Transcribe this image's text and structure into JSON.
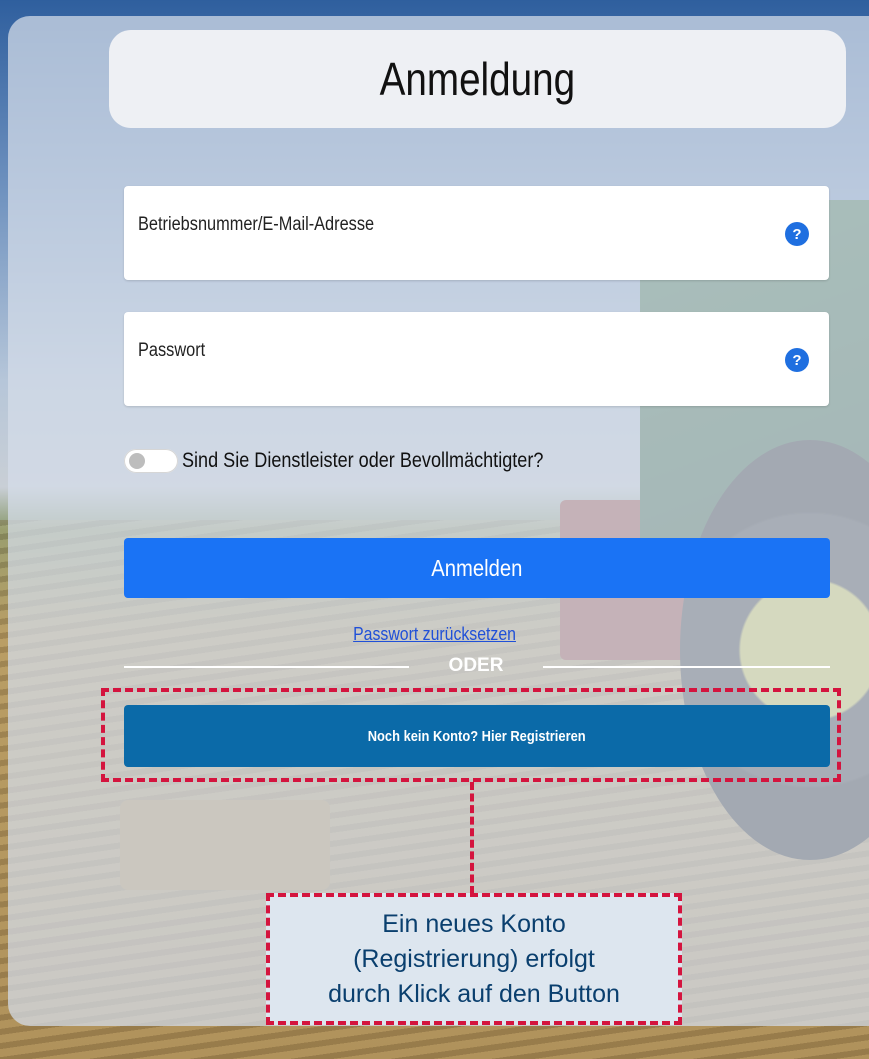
{
  "login": {
    "title": "Anmeldung",
    "username_label": "Betriebsnummer/E-Mail-Adresse",
    "password_label": "Passwort",
    "help_glyph": "?",
    "service_provider_toggle": {
      "label": "Sind Sie Dienstleister oder Bevollmächtigter?",
      "checked": false
    },
    "submit_label": "Anmelden",
    "reset_link": "Passwort zurücksetzen",
    "separator": "ODER",
    "register_label": "Noch kein Konto? Hier Registrieren"
  },
  "annotation": {
    "callout_text": "Ein neues Konto\n(Registrierung) erfolgt\ndurch Klick auf den Button",
    "highlight_color": "#d4143e"
  },
  "colors": {
    "primary": "#1a73f5",
    "register": "#0b6aa8",
    "help_icon": "#1f6fe0"
  },
  "icons": [
    "help-icon",
    "toggle-switch"
  ]
}
